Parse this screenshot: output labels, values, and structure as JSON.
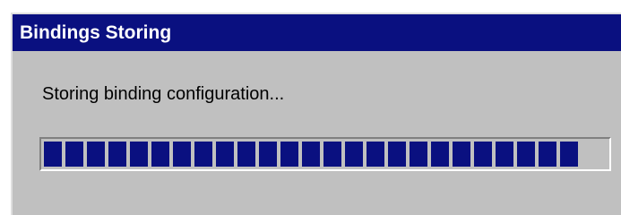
{
  "window": {
    "title": "Bindings Storing"
  },
  "status": {
    "message": "Storing binding configuration..."
  },
  "progress": {
    "value": 0.955
  },
  "colors": {
    "title_bar": "#0a1080",
    "title_text": "#ffffff",
    "dialog_face": "#c0c0c0",
    "progress_block": "#0a1080"
  }
}
